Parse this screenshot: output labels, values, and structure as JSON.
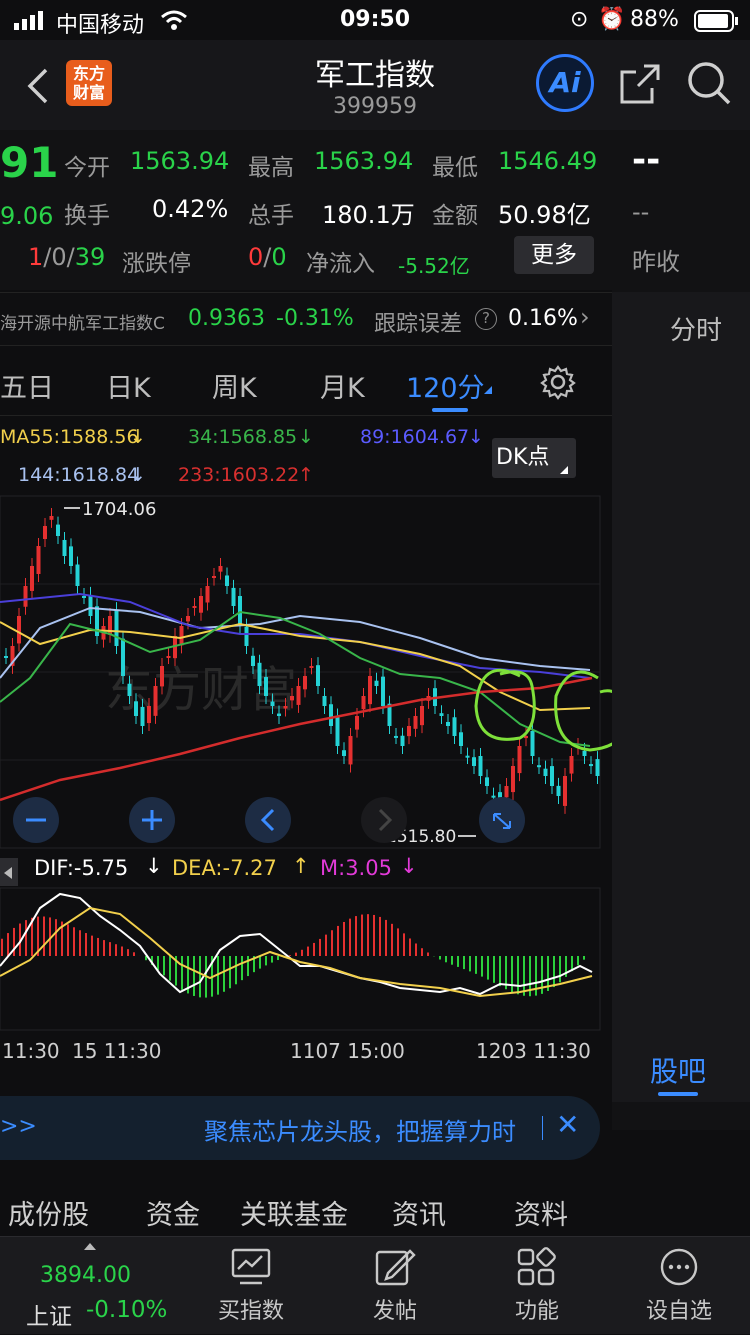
{
  "status_bar": {
    "carrier": "中国移动",
    "time": "09:50",
    "battery_pct": "88%"
  },
  "header": {
    "logo_line1": "东方",
    "logo_line2": "财富",
    "title": "军工指数",
    "code": "399959",
    "ai_label": "Ai"
  },
  "quote": {
    "price_fragment": "91",
    "change_fragment": "9.06",
    "open_label": "今开",
    "open_value": "1563.94",
    "high_label": "最高",
    "high_value": "1563.94",
    "low_label": "最低",
    "low_value": "1546.49",
    "turnover_label": "换手",
    "turnover_value": "0.42%",
    "volume_label": "总手",
    "volume_value": "180.1万",
    "amount_label": "金额",
    "amount_value": "50.98亿",
    "up": "1",
    "sep1": "/",
    "flat": "0",
    "sep2": "/",
    "down": "39",
    "limit_label": "涨跌停",
    "limit_up": "0",
    "limit_sep": "/",
    "limit_down": "0",
    "netflow_label": "净流入",
    "netflow_value": "-5.52亿",
    "more_button": "更多"
  },
  "right_panel": {
    "dash1": "--",
    "dash2": "--",
    "prev_close_label": "昨收",
    "intraday_tab": "分时",
    "guba_tab": "股吧"
  },
  "fund": {
    "name": "海开源中航军工指数C",
    "nav": "0.9363",
    "change": "-0.31%",
    "tracking_label": "跟踪误差",
    "tracking_value": "0.16%"
  },
  "kline_tabs": [
    "五日",
    "日K",
    "周K",
    "月K",
    "120分"
  ],
  "ma": {
    "ma55": "MA55:1588.56",
    "ma34": "34:1568.85",
    "ma89": "89:1604.67",
    "ma144": "144:1618.84",
    "ma233": "233:1603.22",
    "dk_button": "DK点"
  },
  "chart": {
    "high_marker": "1704.06",
    "low_marker": "1515.80",
    "dif": "DIF:-5.75",
    "dea": "DEA:-7.27",
    "m": "M:3.05",
    "time_labels": [
      "11:30",
      "15 11:30",
      "1107 15:00",
      "1203 11:30"
    ]
  },
  "chart_data": {
    "type": "candlestick",
    "series": [
      {
        "name": "MA55",
        "value": 1588.56
      },
      {
        "name": "MA34",
        "value": 1568.85
      },
      {
        "name": "MA89",
        "value": 1604.67
      },
      {
        "name": "MA144",
        "value": 1618.84
      },
      {
        "name": "MA233",
        "value": 1603.22
      }
    ],
    "high": 1704.06,
    "low": 1515.8,
    "macd": {
      "dif": -5.75,
      "dea": -7.27,
      "m": 3.05
    }
  },
  "banner": {
    "arrows": ">>",
    "text": "聚焦芯片龙头股，把握算力时"
  },
  "bottom_tabs": [
    "成份股",
    "资金",
    "关联基金",
    "资讯",
    "资料"
  ],
  "tabbar": {
    "index_value": "3894.00",
    "index_name": "上证",
    "index_change": "-0.10%",
    "items": [
      "买指数",
      "发帖",
      "功能",
      "设自选"
    ]
  },
  "colors": {
    "up": "#ff3b3b",
    "down": "#2ad34a",
    "accent": "#3b8cff"
  }
}
